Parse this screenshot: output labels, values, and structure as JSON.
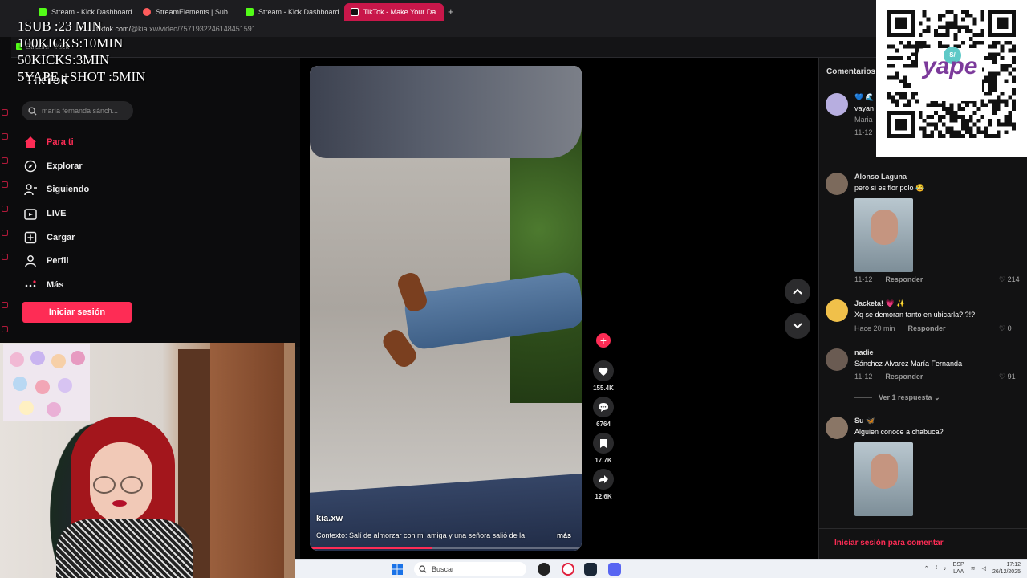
{
  "browser": {
    "tabs": [
      {
        "label": "Stream - Kick Dashboard",
        "favicon": "kick-icon",
        "color": "#53fc18"
      },
      {
        "label": "StreamElements | Sub",
        "favicon": "streamelements-icon",
        "color": "#ff5c5c"
      },
      {
        "label": "Stream - Kick Dashboard",
        "favicon": "kick-icon",
        "color": "#53fc18"
      },
      {
        "label": "TikTok - Make Your Da",
        "favicon": "tiktok-icon",
        "color": "#ffffff"
      }
    ],
    "url_prefix": "tiktok.com/",
    "url_rest": "@kia.xw/video/7571932246148451591",
    "bookmark": "Stream - Kick"
  },
  "overlay": {
    "lines": [
      "1SUB :23 MIN",
      "100KICKS:10MIN",
      "50KICKS:3MIN",
      "5YAPE +SHOT :5MIN"
    ]
  },
  "sidebar": {
    "logo": "TikTok",
    "search_placeholder": "maría fernanda sánch...",
    "items": [
      {
        "label": "Para ti",
        "icon": "home-icon"
      },
      {
        "label": "Explorar",
        "icon": "compass-icon"
      },
      {
        "label": "Siguiendo",
        "icon": "following-icon"
      },
      {
        "label": "LIVE",
        "icon": "live-icon"
      },
      {
        "label": "Cargar",
        "icon": "upload-icon"
      },
      {
        "label": "Perfil",
        "icon": "profile-icon"
      },
      {
        "label": "Más",
        "icon": "more-icon"
      }
    ],
    "login": "Iniciar sesión"
  },
  "video": {
    "author": "kia.xw",
    "description": "Contexto: Salí de almorzar con mi amiga y una señora salió de la",
    "more": "más",
    "progress": 0.45,
    "likes": "155.4K",
    "comments": "6764",
    "saves": "17.7K",
    "shares": "12.6K"
  },
  "comments": {
    "title": "Comentarios",
    "items": [
      {
        "name": "💙 🌊",
        "text": "vayan",
        "text2": "Maria",
        "date": "11-12"
      },
      {
        "name": "Alonso Laguna",
        "text": "pero si es flor polo 😂",
        "date": "11-12",
        "reply": "Responder",
        "likes": "214"
      },
      {
        "name": "Jacketa! 💗 ✨",
        "text": "Xq se demoran tanto en ubicarla?!?!?",
        "date": "Hace 20 min",
        "reply": "Responder",
        "likes": "0"
      },
      {
        "name": "nadie",
        "text": "Sánchez Álvarez María Fernanda",
        "date": "11-12",
        "reply": "Responder",
        "likes": "91",
        "replies": "Ver 1 respuesta"
      },
      {
        "name": "Su 🦋",
        "text": "Alguien conoce a chabuca?"
      }
    ],
    "login": "Iniciar sesión para comentar"
  },
  "qr": {
    "brand": "yape",
    "badge": "S/"
  },
  "taskbar": {
    "search": "Buscar",
    "lang": "ESP",
    "lang2": "LAA",
    "time": "17:12",
    "date": "26/12/2025"
  }
}
